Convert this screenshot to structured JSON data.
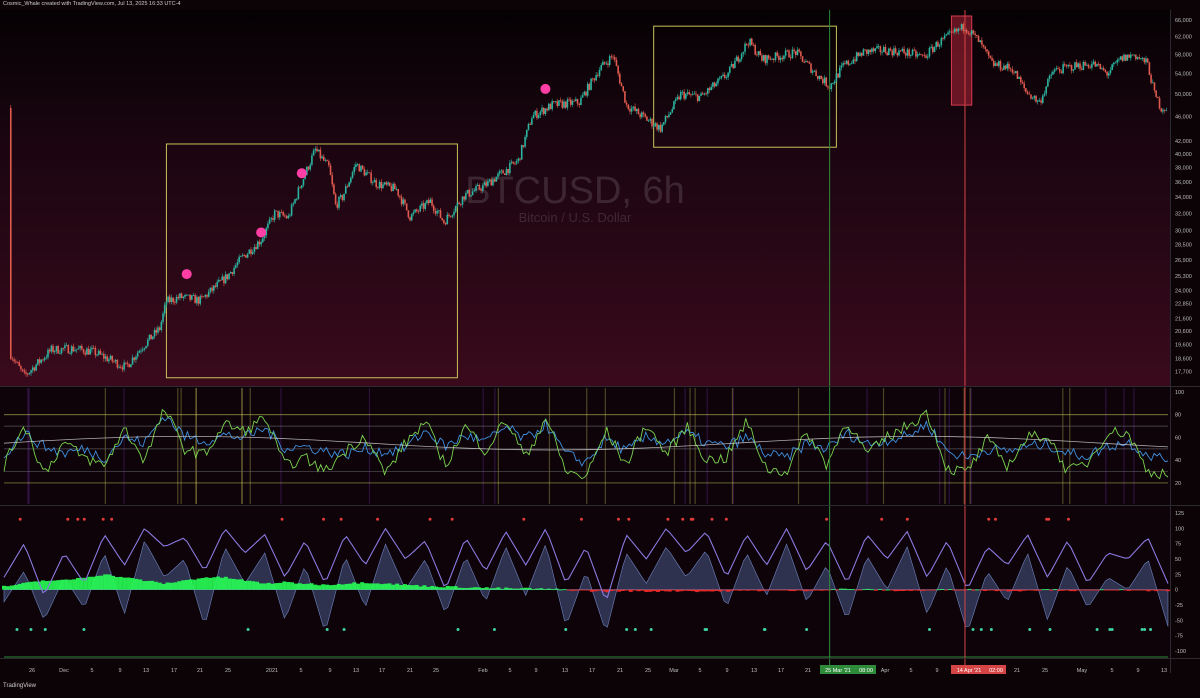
{
  "header": {
    "attribution": "Cosmic_Whale created with TradingView.com, Jul 13, 2025 16:33 UTC-4"
  },
  "footer": {
    "logo_text": "TradingView"
  },
  "watermark": {
    "symbol": "BTCUSD, 6h",
    "description": "Bitcoin / U.S. Dollar"
  },
  "colors": {
    "background_top": "#050103",
    "background_bottom": "#3a0a1c",
    "candle_up": "#2bb5a0",
    "candle_down": "#e05a4f",
    "highlight_box": "#c9c35a",
    "vline_green": "#2e8b3a",
    "vline_red": "#d64545",
    "pink_marker": "#ff3fa5",
    "osc_blue": "#3f8fe0",
    "osc_green": "#7bd34f",
    "wave_purple": "#8a7ae0",
    "money_flow_green": "#27ff55",
    "money_flow_red": "#ff2a2a"
  },
  "chart_data": [
    {
      "type": "candlestick",
      "name": "price",
      "x_ticks": [
        "26",
        "Dec",
        "5",
        "9",
        "13",
        "17",
        "21",
        "25",
        "2021",
        "5",
        "9",
        "13",
        "17",
        "21",
        "25",
        "Feb",
        "5",
        "9",
        "13",
        "17",
        "21",
        "25",
        "Mar",
        "5",
        "9",
        "13",
        "17",
        "21",
        "25 Mar '21",
        "08:00",
        "Apr",
        "5",
        "9",
        "14 Apr '21",
        "02:00",
        "21",
        "25",
        "May",
        "5",
        "9",
        "13"
      ],
      "y_ticks": [
        66000,
        62000,
        58000,
        54000,
        50000,
        46000,
        42000,
        40000,
        38000,
        36000,
        34000,
        32000,
        30000,
        28500,
        26900,
        25300,
        24000,
        22850,
        21600,
        20600,
        19600,
        18600,
        17700
      ],
      "y_scale": "log",
      "ylim": [
        16900,
        67000
      ],
      "close_path": [
        [
          "2020-11-24",
          18900
        ],
        [
          "2020-11-26",
          17400
        ],
        [
          "2020-11-30",
          19200
        ],
        [
          "2020-12-03",
          19300
        ],
        [
          "2020-12-06",
          19100
        ],
        [
          "2020-12-11",
          18000
        ],
        [
          "2020-12-13",
          19200
        ],
        [
          "2020-12-16",
          20800
        ],
        [
          "2020-12-17",
          23000
        ],
        [
          "2020-12-19",
          23400
        ],
        [
          "2020-12-22",
          23100
        ],
        [
          "2020-12-26",
          25300
        ],
        [
          "2020-12-28",
          27000
        ],
        [
          "2020-12-31",
          29000
        ],
        [
          "2021-01-02",
          32000
        ],
        [
          "2021-01-04",
          31500
        ],
        [
          "2021-01-06",
          36000
        ],
        [
          "2021-01-08",
          40600
        ],
        [
          "2021-01-10",
          38000
        ],
        [
          "2021-01-11",
          33000
        ],
        [
          "2021-01-12",
          34000
        ],
        [
          "2021-01-14",
          38500
        ],
        [
          "2021-01-17",
          35800
        ],
        [
          "2021-01-20",
          35000
        ],
        [
          "2021-01-22",
          31600
        ],
        [
          "2021-01-25",
          33500
        ],
        [
          "2021-01-27",
          31000
        ],
        [
          "2021-01-30",
          34200
        ],
        [
          "2021-02-02",
          35500
        ],
        [
          "2021-02-05",
          37500
        ],
        [
          "2021-02-07",
          39000
        ],
        [
          "2021-02-09",
          46000
        ],
        [
          "2021-02-12",
          48000
        ],
        [
          "2021-02-16",
          48500
        ],
        [
          "2021-02-19",
          55000
        ],
        [
          "2021-02-21",
          57800
        ],
        [
          "2021-02-23",
          48000
        ],
        [
          "2021-02-26",
          45500
        ],
        [
          "2021-02-28",
          44000
        ],
        [
          "2021-03-03",
          50000
        ],
        [
          "2021-03-06",
          49500
        ],
        [
          "2021-03-10",
          54000
        ],
        [
          "2021-03-13",
          61000
        ],
        [
          "2021-03-15",
          57000
        ],
        [
          "2021-03-17",
          57500
        ],
        [
          "2021-03-20",
          58500
        ],
        [
          "2021-03-23",
          54000
        ],
        [
          "2021-03-25",
          51500
        ],
        [
          "2021-03-27",
          55500
        ],
        [
          "2021-03-30",
          58500
        ],
        [
          "2021-04-02",
          59000
        ],
        [
          "2021-04-05",
          58500
        ],
        [
          "2021-04-08",
          57500
        ],
        [
          "2021-04-10",
          60500
        ],
        [
          "2021-04-14",
          64500
        ],
        [
          "2021-04-16",
          61000
        ],
        [
          "2021-04-18",
          56000
        ],
        [
          "2021-04-21",
          55000
        ],
        [
          "2021-04-23",
          50500
        ],
        [
          "2021-04-25",
          48500
        ],
        [
          "2021-04-27",
          54500
        ],
        [
          "2021-04-30",
          55500
        ],
        [
          "2021-05-03",
          56000
        ],
        [
          "2021-05-05",
          54000
        ],
        [
          "2021-05-07",
          57000
        ],
        [
          "2021-05-09",
          58000
        ],
        [
          "2021-05-11",
          56000
        ],
        [
          "2021-05-12",
          50000
        ],
        [
          "2021-05-13",
          47500
        ]
      ],
      "annotations": {
        "boxes": [
          {
            "from": "2020-12-17",
            "to": "2021-01-29",
            "high": 41500,
            "low": 17300
          },
          {
            "from": "2021-02-27",
            "to": "2021-03-26",
            "high": 64500,
            "low": 41000
          }
        ],
        "red_zone": {
          "from": "2021-04-12",
          "to": "2021-04-15",
          "high": 67000,
          "low": 48000
        },
        "vertical_lines": [
          {
            "date": "2021-03-25",
            "color": "green",
            "label": "25 Mar '21 08:00"
          },
          {
            "date": "2021-04-14",
            "color": "red",
            "label": "14 Apr '21 02:00"
          }
        ],
        "pink_markers": [
          {
            "date": "2020-12-20",
            "price": 25500
          },
          {
            "date": "2020-12-31",
            "price": 29800
          },
          {
            "date": "2021-01-06",
            "price": 37200
          },
          {
            "date": "2021-02-11",
            "price": 51000
          }
        ]
      }
    },
    {
      "type": "line",
      "name": "rsi-oscillator",
      "y_ticks": [
        100,
        80,
        60,
        40,
        20
      ],
      "ylim": [
        5,
        100
      ],
      "levels": [
        80,
        70,
        50,
        30,
        20
      ],
      "series": [
        {
          "name": "",
          "color": "blue",
          "values": [
            45,
            64,
            52,
            46,
            50,
            42,
            60,
            55,
            80,
            61,
            57,
            62,
            60,
            68,
            51,
            52,
            48,
            45,
            50,
            47,
            51,
            66,
            52,
            62,
            56,
            69,
            58,
            72,
            45,
            38,
            59,
            48,
            60,
            56,
            64,
            55,
            52,
            60,
            45,
            42,
            55,
            50,
            64,
            54,
            58,
            61,
            72,
            48,
            42,
            50,
            48,
            52,
            54,
            46,
            44,
            52,
            56,
            45,
            40
          ]
        },
        {
          "name": "",
          "color": "green",
          "values": [
            35,
            72,
            28,
            56,
            42,
            35,
            68,
            40,
            85,
            50,
            45,
            72,
            65,
            78,
            35,
            42,
            30,
            48,
            62,
            28,
            55,
            74,
            35,
            70,
            48,
            76,
            42,
            78,
            30,
            25,
            66,
            36,
            72,
            45,
            70,
            40,
            42,
            74,
            32,
            30,
            65,
            36,
            75,
            45,
            60,
            70,
            82,
            32,
            30,
            58,
            35,
            60,
            62,
            30,
            38,
            65,
            64,
            30,
            28
          ]
        }
      ]
    },
    {
      "type": "area",
      "name": "wave-oscillator",
      "y_ticks": [
        125,
        100,
        75,
        50,
        25,
        0,
        -25,
        -50,
        -75,
        -100
      ],
      "ylim": [
        -105,
        130
      ],
      "series": [
        {
          "name": "",
          "color": "purple",
          "values": [
            20,
            75,
            -10,
            60,
            10,
            90,
            40,
            100,
            70,
            85,
            30,
            100,
            60,
            90,
            20,
            80,
            10,
            90,
            40,
            100,
            50,
            80,
            0,
            85,
            30,
            95,
            40,
            100,
            10,
            70,
            -20,
            90,
            50,
            100,
            60,
            95,
            20,
            90,
            40,
            100,
            30,
            80,
            10,
            90,
            50,
            95,
            20,
            80,
            0,
            70,
            40,
            90,
            20,
            80,
            10,
            60,
            50,
            85,
            10
          ]
        },
        {
          "name": "",
          "color": "slate",
          "values": [
            -20,
            30,
            -50,
            20,
            -30,
            60,
            -40,
            80,
            20,
            50,
            -60,
            70,
            10,
            60,
            -50,
            40,
            -70,
            55,
            -30,
            75,
            0,
            50,
            -40,
            55,
            -20,
            70,
            -10,
            75,
            -60,
            30,
            -70,
            60,
            10,
            70,
            20,
            65,
            -30,
            60,
            -10,
            75,
            -20,
            40,
            -50,
            55,
            0,
            70,
            -40,
            40,
            -70,
            30,
            -20,
            60,
            -50,
            40,
            -30,
            20,
            0,
            50,
            -60
          ]
        },
        {
          "name": "",
          "color": "green/red money flow",
          "values": [
            5,
            10,
            15,
            15,
            20,
            25,
            20,
            15,
            10,
            15,
            20,
            20,
            15,
            10,
            12,
            10,
            8,
            10,
            12,
            10,
            8,
            6,
            5,
            4,
            3,
            2,
            2,
            1,
            0,
            -2,
            -3,
            -2,
            -3,
            -2,
            -2,
            -3,
            -2,
            -2,
            -1,
            -2,
            -1,
            0,
            1,
            0,
            -1,
            -2,
            -1,
            0,
            0,
            -1,
            -2,
            -1,
            0,
            -1,
            -2,
            0,
            -1,
            -2,
            -1
          ]
        }
      ]
    }
  ]
}
